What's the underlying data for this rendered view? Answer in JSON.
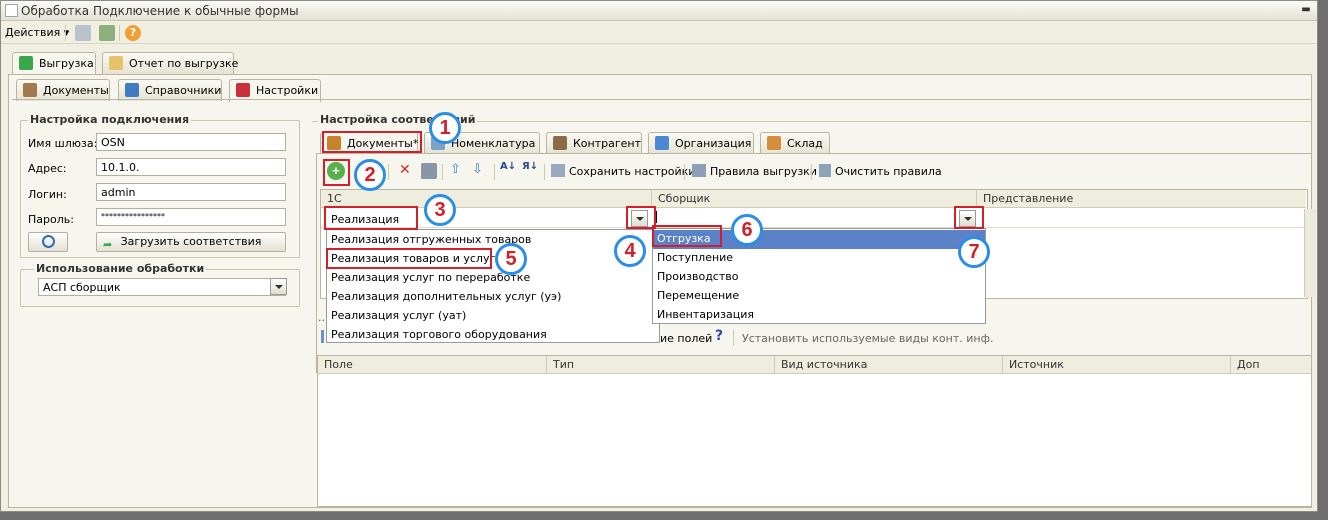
{
  "window": {
    "title": "Обработка  Подключение к обычные формы"
  },
  "toolbar": {
    "actions_label": "Действия"
  },
  "main_tabs": [
    {
      "label": "Выгрузка"
    },
    {
      "label": "Отчет по выгрузке"
    }
  ],
  "sub_tabs": [
    {
      "label": "Документы"
    },
    {
      "label": "Справочники"
    },
    {
      "label": "Настройки"
    }
  ],
  "connection": {
    "title": "Настройка подключения",
    "gateway_label": "Имя шлюза:",
    "gateway_value": "OSN",
    "address_label": "Адрес:",
    "address_value": "10.1.0.",
    "login_label": "Логин:",
    "login_value": "admin",
    "password_label": "Пароль:",
    "password_value": "****************",
    "load_button": "Загрузить соответствия"
  },
  "usage": {
    "title": "Использование обработки",
    "selected": "АСП сборщик"
  },
  "mapping": {
    "title": "Настройка соответствий",
    "tabs": [
      {
        "label": "Документы*"
      },
      {
        "label": "Номенклатура"
      },
      {
        "label": "Контрагент"
      },
      {
        "label": "Организация"
      },
      {
        "label": "Склад"
      }
    ],
    "save_settings": "Сохранить настройки",
    "export_rules": "Правила выгрузки",
    "clear_rules": "Очистить правила",
    "columns": [
      "1С",
      "Сборщик",
      "Представление"
    ],
    "row_1c_value": "Реализация",
    "fields_link": "ие полей",
    "set_contact_types": "Установить используемые виды конт. инф.",
    "lower_columns": [
      "Поле",
      "Тип",
      "Вид источника",
      "Источник",
      "Доп"
    ],
    "dropdown_1c": [
      "Реализация отгруженных товаров",
      "Реализация товаров и услуг",
      "Реализация услуг по переработке",
      "Реализация дополнительных услуг (уэ)",
      "Реализация услуг (уат)",
      "Реализация торгового оборудования"
    ],
    "dropdown_picker": [
      "Отгрузка",
      "Поступление",
      "Производство",
      "Перемещение",
      "Инвентаризация"
    ]
  },
  "markers": [
    "1",
    "2",
    "3",
    "4",
    "5",
    "6",
    "7"
  ]
}
